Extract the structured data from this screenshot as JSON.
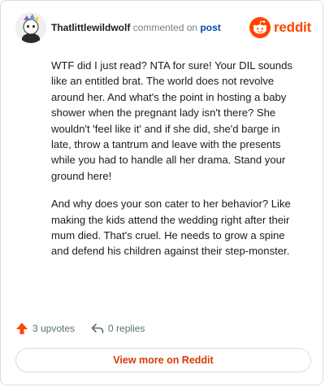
{
  "header": {
    "username": "Thatlittlewildwolf",
    "verb": "commented on",
    "post_link": "post",
    "logo_text": "reddit"
  },
  "comment": {
    "paragraphs": [
      "WTF did I just read? NTA for sure! Your DIL sounds like an entitled brat. The world does not revolve around her. And what's the point in hosting a baby shower when the pregnant lady isn't there? She wouldn't 'feel like it' and if she did, she'd barge in late, throw a tantrum and leave with the presents while you had to handle all her drama. Stand your ground here!",
      "And why does your son cater to her behavior? Like making the kids attend the wedding right after their mum died. That's cruel. He needs to grow a spine and defend his children against their step-monster."
    ]
  },
  "actions": {
    "upvotes": "3 upvotes",
    "replies": "0 replies"
  },
  "footer": {
    "view_more": "View more on Reddit"
  },
  "colors": {
    "accent": "#ff4500",
    "link": "#0045ac",
    "muted": "#576f76"
  },
  "icons": {
    "avatar": "snoo-avatar",
    "logo": "reddit-snoo-icon",
    "upvote": "upvote-arrow-icon",
    "reply": "reply-arrow-icon"
  }
}
